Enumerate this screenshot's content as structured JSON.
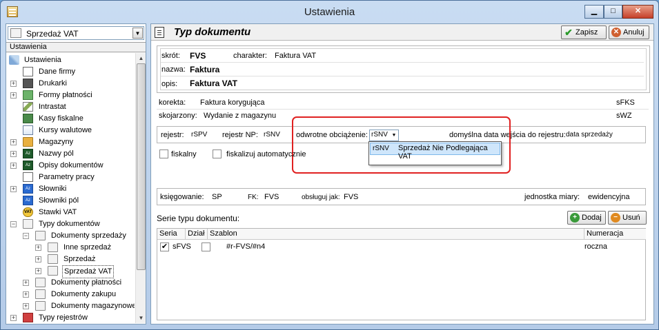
{
  "window": {
    "title": "Ustawienia",
    "controls": {
      "minimize": "▁",
      "maximize": "□",
      "close": "✕"
    }
  },
  "left": {
    "combo_value": "Sprzedaż VAT",
    "tree_header": "Ustawienia",
    "tree": {
      "root": "Ustawienia",
      "items": [
        "Dane firmy",
        "Drukarki",
        "Formy płatności",
        "Intrastat",
        "Kasy fiskalne",
        "Kursy walutowe",
        "Magazyny",
        "Nazwy pól",
        "Opisy dokumentów",
        "Parametry pracy",
        "Słowniki",
        "Słowniki pól",
        "Stawki VAT",
        "Typy dokumentów"
      ],
      "sub": {
        "sprzedazy": "Dokumenty sprzedaży",
        "inne": "Inne sprzedaż",
        "sprzedaz": "Sprzedaż",
        "sprzedaz_vat": "Sprzedaż VAT",
        "platnosci": "Dokumenty płatności",
        "zakupu": "Dokumenty zakupu",
        "magazynowe": "Dokumenty magazynowe",
        "rejestrow": "Typy rejestrów"
      }
    }
  },
  "right": {
    "title": "Typ dokumentu",
    "save_label": "Zapisz",
    "cancel_label": "Anuluj",
    "skrot_label": "skrót:",
    "skrot_value": "FVS",
    "charakter_label": "charakter:",
    "charakter_value": "Faktura VAT",
    "nazwa_label": "nazwa:",
    "nazwa_value": "Faktura",
    "opis_label": "opis:",
    "opis_value": "Faktura VAT",
    "korekta_label": "korekta:",
    "korekta_value": "Faktura korygująca",
    "korekta_code": "sFKS",
    "skojarzony_label": "skojarzony:",
    "skojarzony_value": "Wydanie z magazynu",
    "skojarzony_code": "sWZ",
    "rejestr_label": "rejestr:",
    "rejestr_value": "rSPV",
    "rejestr_np_label": "rejestr NP:",
    "rejestr_np_value": "rSNV",
    "odwrotne_label": "odwrotne obciążenie:",
    "odwrotne_value": "rSNV",
    "data_label": "domyślna data wejścia do rejestru:",
    "data_value": "data sprzedaży",
    "dropdown_code": "rSNV",
    "dropdown_text": "Sprzedaż Nie Podlegająca VAT",
    "fiskalny_label": "fiskalny",
    "fiskalizuj_label": "fiskalizuj automatycznie",
    "ksiegowanie_label": "księgowanie:",
    "ksiegowanie_value": "SP",
    "fk_label": "FK:",
    "fk_value": "FVS",
    "obsluguj_label": "obsługuj jak:",
    "obsluguj_value": "FVS",
    "jm_label": "jednostka miary:",
    "jm_value": "ewidencyjna",
    "serie_label": "Serie typu dokumentu:",
    "dodaj_label": "Dodaj",
    "usun_label": "Usuń",
    "table": {
      "headers": [
        "Seria",
        "Dział",
        "Szablon",
        "Numeracja"
      ],
      "row": {
        "seria": "sFVS",
        "szablon": "#r-FVS/#n4",
        "numeracja": "roczna",
        "seria_checked": "✔"
      }
    }
  }
}
